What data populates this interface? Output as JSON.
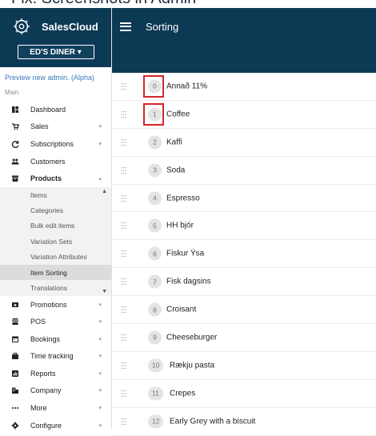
{
  "top_strip": "Fix: Screenshots in Admin",
  "brand": {
    "name": "SalesCloud",
    "logo_icon": "salescloud-logo-icon"
  },
  "venue": {
    "label": "ED'S DINER",
    "chevron": "▾"
  },
  "sidebar": {
    "preview_link": "Preview new admin. (Alpha)",
    "section_label": "Main",
    "items_before": [
      {
        "key": "dashboard",
        "label": "Dashboard",
        "icon": "dashboard-icon",
        "chev": ""
      },
      {
        "key": "sales",
        "label": "Sales",
        "icon": "cart-icon",
        "chev": "▾"
      },
      {
        "key": "subscriptions",
        "label": "Subscriptions",
        "icon": "refresh-icon",
        "chev": "▾"
      },
      {
        "key": "customers",
        "label": "Customers",
        "icon": "people-icon",
        "chev": ""
      },
      {
        "key": "products",
        "label": "Products",
        "icon": "archive-icon",
        "chev": "▴"
      }
    ],
    "products_sub": [
      "Items",
      "Categories",
      "Bulk edit items",
      "Variation Sets",
      "Variation Attributes",
      "Item Sorting",
      "Translations"
    ],
    "products_sub_current": "Item Sorting",
    "items_after": [
      {
        "key": "promotions",
        "label": "Promotions",
        "icon": "ticket-icon",
        "chev": "▾"
      },
      {
        "key": "pos",
        "label": "POS",
        "icon": "pos-icon",
        "chev": "▾"
      },
      {
        "key": "bookings",
        "label": "Bookings",
        "icon": "calendar-icon",
        "chev": "▾"
      },
      {
        "key": "time-tracking",
        "label": "Time tracking",
        "icon": "briefcase-icon",
        "chev": "▾"
      },
      {
        "key": "reports",
        "label": "Reports",
        "icon": "chart-icon",
        "chev": "▾"
      },
      {
        "key": "company",
        "label": "Company",
        "icon": "building-icon",
        "chev": "▾"
      },
      {
        "key": "more",
        "label": "More",
        "icon": "dots-icon",
        "chev": "▾"
      },
      {
        "key": "configure",
        "label": "Configure",
        "icon": "gear-icon",
        "chev": "▾"
      }
    ]
  },
  "header": {
    "title": "Sorting",
    "menu_icon": "hamburger-icon"
  },
  "items": [
    {
      "index": "0",
      "name": "Annað 11%",
      "highlighted": true
    },
    {
      "index": "1",
      "name": "Coffee",
      "highlighted": true
    },
    {
      "index": "2",
      "name": "Kaffi"
    },
    {
      "index": "3",
      "name": "Soda"
    },
    {
      "index": "4",
      "name": "Espresso"
    },
    {
      "index": "5",
      "name": "HH bjór"
    },
    {
      "index": "6",
      "name": "Fiskur Ýsa"
    },
    {
      "index": "7",
      "name": "Fisk dagsins"
    },
    {
      "index": "8",
      "name": "Croisant"
    },
    {
      "index": "9",
      "name": "Cheeseburger"
    },
    {
      "index": "10",
      "name": "Rækju pasta"
    },
    {
      "index": "11",
      "name": "Crepes"
    },
    {
      "index": "12",
      "name": "Early Grey with a biscuit"
    }
  ],
  "colors": {
    "header": "#0c3a55",
    "highlight": "#d0272d",
    "link": "#3b7bbf"
  }
}
